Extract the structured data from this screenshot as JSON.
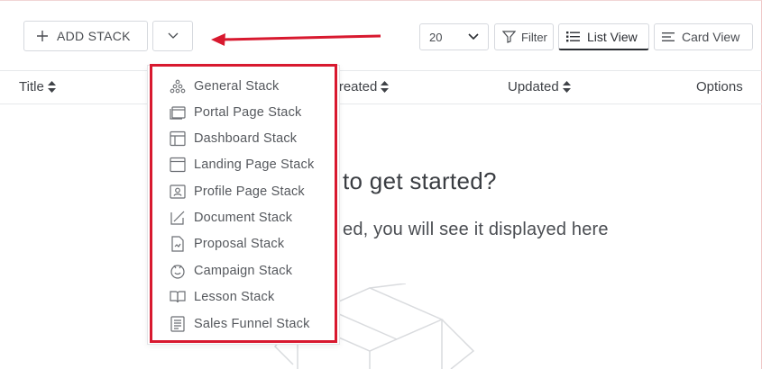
{
  "toolbar": {
    "add_stack_label": "ADD STACK",
    "page_size": "20",
    "filter_label": "Filter",
    "list_view_label": "List View",
    "card_view_label": "Card View"
  },
  "table": {
    "columns": [
      "Title",
      "Created",
      "Updated",
      "Options"
    ]
  },
  "empty_state": {
    "title": "to get started?",
    "subtitle": "ed, you will see it displayed here"
  },
  "dropdown": {
    "items": [
      {
        "label": "General Stack",
        "icon": "general-stack-icon"
      },
      {
        "label": "Portal Page Stack",
        "icon": "portal-page-icon"
      },
      {
        "label": "Dashboard Stack",
        "icon": "dashboard-icon"
      },
      {
        "label": "Landing Page Stack",
        "icon": "landing-page-icon"
      },
      {
        "label": "Profile Page Stack",
        "icon": "profile-page-icon"
      },
      {
        "label": "Document Stack",
        "icon": "document-icon"
      },
      {
        "label": "Proposal Stack",
        "icon": "proposal-icon"
      },
      {
        "label": "Campaign Stack",
        "icon": "campaign-icon"
      },
      {
        "label": "Lesson Stack",
        "icon": "lesson-icon"
      },
      {
        "label": "Sales Funnel Stack",
        "icon": "sales-funnel-icon"
      }
    ]
  },
  "colors": {
    "annotation_red": "#d8192f",
    "text_dark": "#3a3d42",
    "border": "#d6d9de"
  }
}
